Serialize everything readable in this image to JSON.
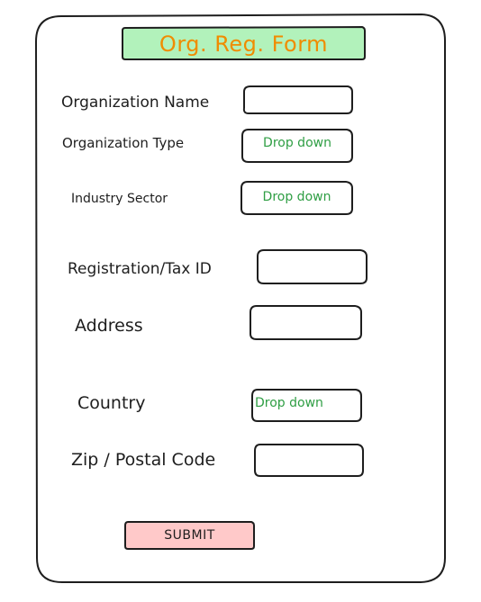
{
  "form": {
    "title": "Org. Reg. Form",
    "fields": {
      "organization_name": {
        "label": "Organization Name",
        "value": ""
      },
      "organization_type": {
        "label": "Organization Type",
        "value": "Drop down"
      },
      "industry_sector": {
        "label": "Industry Sector",
        "value": "Drop down"
      },
      "registration_tax_id": {
        "label": "Registration/Tax ID",
        "value": ""
      },
      "address": {
        "label": "Address",
        "value": ""
      },
      "country": {
        "label": "Country",
        "value": "Drop down"
      },
      "zip_postal_code": {
        "label": "Zip / Postal Code",
        "value": ""
      }
    },
    "submit_label": "SUBMIT"
  },
  "colors": {
    "stroke": "#1e1e1e",
    "title_fill": "#b2f2bb",
    "title_text": "#f08c00",
    "dropdown_text": "#2f9e44",
    "submit_fill": "#ffc9c9"
  }
}
